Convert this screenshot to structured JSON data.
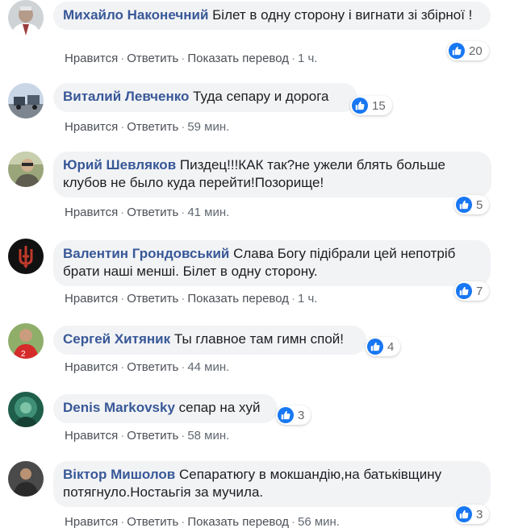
{
  "theme": {
    "link": "#385898",
    "bubble": "#f2f3f5",
    "like_blue": "#1877f2"
  },
  "action_labels": {
    "like": "Нравится",
    "reply": "Ответить",
    "translate": "Показать перевод",
    "sep": "·"
  },
  "comments": [
    {
      "author": "Михайло Наконечний",
      "text": "Білет в одну сторону і вигнати зі збірної !",
      "has_translate": true,
      "time": "1 ч.",
      "likes": "20",
      "avatar_icon": "avatar-photo-icon"
    },
    {
      "author": "Виталий Левченко",
      "text": "Туда сепару и дорога",
      "has_translate": false,
      "time": "59 мин.",
      "likes": "15",
      "avatar_icon": "avatar-photo-icon"
    },
    {
      "author": "Юрий Шевляков",
      "text": "Пиздец!!!КАК так?не ужели блять больше клубов не было куда перейти!Позорище!",
      "has_translate": false,
      "time": "41 мин.",
      "likes": "5",
      "avatar_icon": "avatar-photo-icon"
    },
    {
      "author": "Валентин Грондовський",
      "text": "Слава Богу підібрали цей непотріб брати наші менші. Білет в одну сторону.",
      "has_translate": true,
      "time": "1 ч.",
      "likes": "7",
      "avatar_icon": "trident-avatar-icon"
    },
    {
      "author": "Сергей Хитяник",
      "text": "Ты главное там гимн спой!",
      "has_translate": false,
      "time": "44 мин.",
      "likes": "4",
      "avatar_icon": "avatar-photo-icon"
    },
    {
      "author": "Denis Markovsky",
      "text": "сепар на хуй",
      "has_translate": false,
      "time": "58 мин.",
      "likes": "3",
      "avatar_icon": "avatar-photo-icon"
    },
    {
      "author": "Віктор Мишолов",
      "text": "Сепаратюгу в мокшандію,на батьківщину потягнуло.Ностаьгія за мучила.",
      "has_translate": true,
      "time": "56 мин.",
      "likes": "3",
      "avatar_icon": "avatar-photo-icon"
    }
  ]
}
